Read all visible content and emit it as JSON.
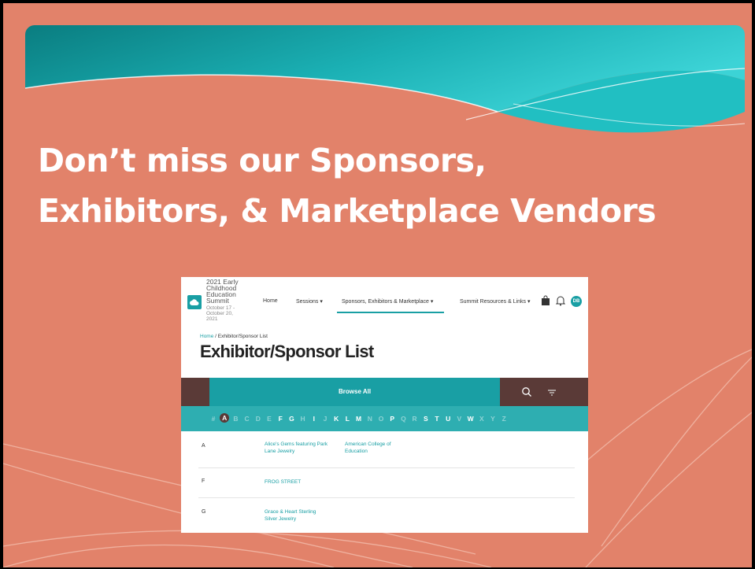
{
  "slide": {
    "headline_line1": "Don’t miss our Sponsors,",
    "headline_line2": "Exhibitors, & Marketplace Vendors"
  },
  "site": {
    "event_title": "2021 Early Childhood Education Summit",
    "event_dates": "October 17 - October 20, 2021",
    "nav": {
      "home": "Home",
      "sessions": "Sessions ▾",
      "sponsors": "Sponsors, Exhibitors & Marketplace ▾",
      "resources": "Summit Resources & Links ▾"
    },
    "avatar_initials": "DB"
  },
  "page": {
    "breadcrumb_home": "Home",
    "breadcrumb_sep": " / ",
    "breadcrumb_current": "Exhibitor/Sponsor List",
    "title": "Exhibitor/Sponsor List",
    "browse_all": "Browse All"
  },
  "alphabet": {
    "letters": [
      "#",
      "A",
      "B",
      "C",
      "D",
      "E",
      "F",
      "G",
      "H",
      "I",
      "J",
      "K",
      "L",
      "M",
      "N",
      "O",
      "P",
      "Q",
      "R",
      "S",
      "T",
      "U",
      "V",
      "W",
      "X",
      "Y",
      "Z"
    ],
    "active": [
      "A",
      "F",
      "G",
      "I",
      "K",
      "L",
      "M",
      "P",
      "S",
      "T",
      "U",
      "W"
    ],
    "selected": "A"
  },
  "groups": [
    {
      "letter": "A",
      "items": [
        "Alice's Gems featuring Park Lane Jewelry",
        "American College of Education"
      ]
    },
    {
      "letter": "F",
      "items": [
        "FROG STREET"
      ]
    },
    {
      "letter": "G",
      "items": [
        "Grace & Heart Sterling Silver Jewelry"
      ]
    }
  ],
  "colors": {
    "slide_bg": "#e2826a",
    "teal": "#199fa4",
    "dark_brown": "#5a3a37"
  },
  "icons": [
    "cloud-icon",
    "bag-icon",
    "bell-icon",
    "search-icon",
    "filter-icon"
  ]
}
